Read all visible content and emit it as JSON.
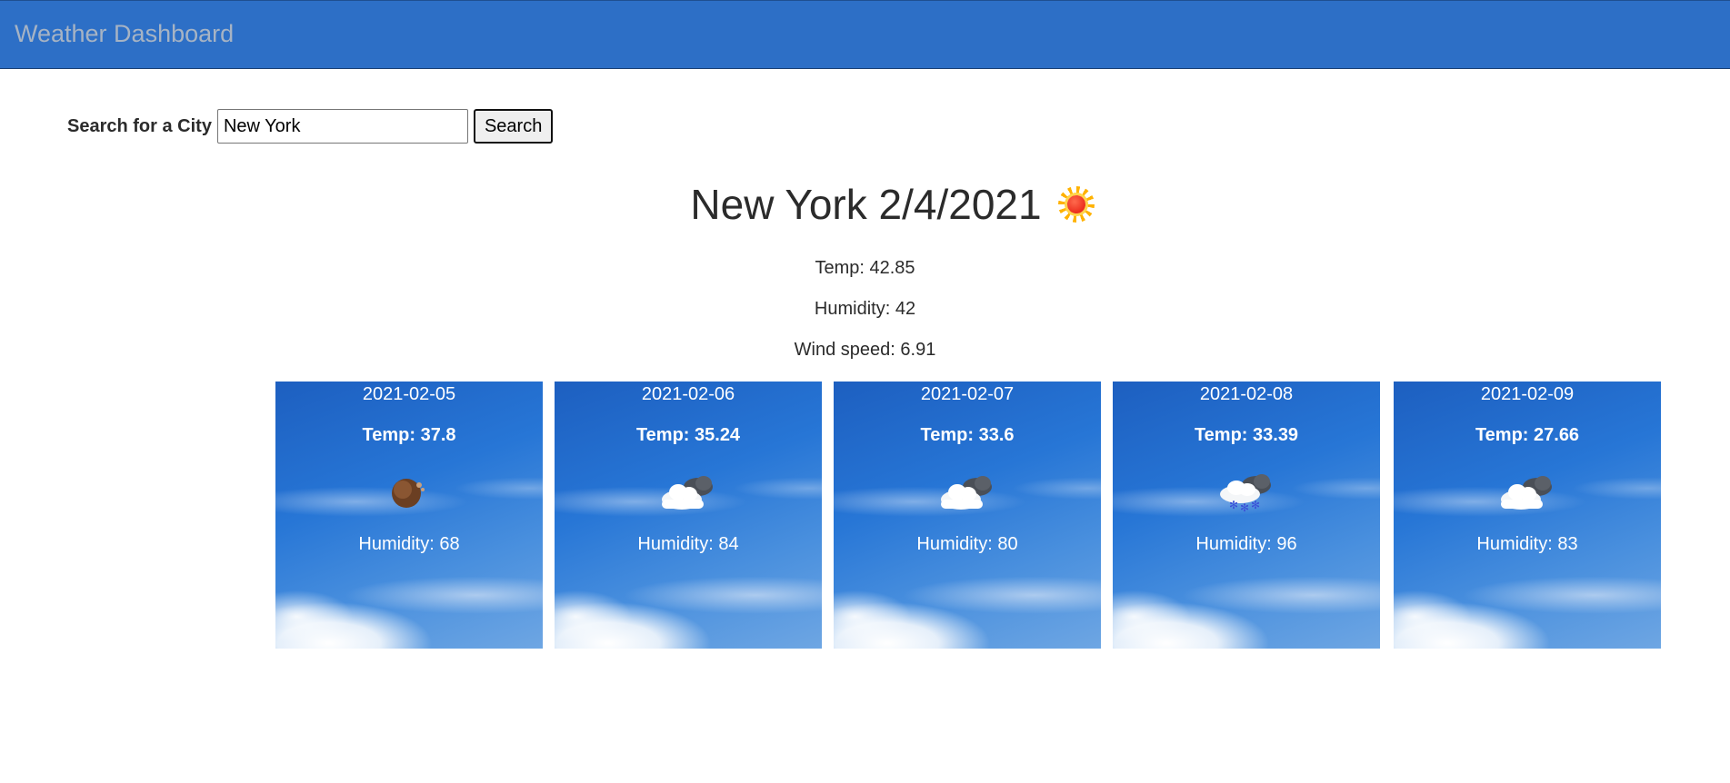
{
  "navbar": {
    "brand": "Weather Dashboard",
    "color": "#2d6fc6"
  },
  "search": {
    "label": "Search for a City",
    "value": "New York",
    "button_label": "Search"
  },
  "current": {
    "title": "New York 2/4/2021",
    "icon": "clear-sky-sun-icon",
    "temp": "Temp: 42.85",
    "humidity": "Humidity: 42",
    "wind": "Wind speed: 6.91"
  },
  "forecast": [
    {
      "date": "2021-02-05",
      "temp": "Temp: 37.8",
      "icon": "rain-cloud-icon",
      "humidity": "Humidity: 68"
    },
    {
      "date": "2021-02-06",
      "temp": "Temp: 35.24",
      "icon": "broken-clouds-icon",
      "humidity": "Humidity: 84"
    },
    {
      "date": "2021-02-07",
      "temp": "Temp: 33.6",
      "icon": "broken-clouds-icon",
      "humidity": "Humidity: 80"
    },
    {
      "date": "2021-02-08",
      "temp": "Temp: 33.39",
      "icon": "snow-cloud-icon",
      "humidity": "Humidity: 96"
    },
    {
      "date": "2021-02-09",
      "temp": "Temp: 27.66",
      "icon": "broken-clouds-icon",
      "humidity": "Humidity: 83"
    }
  ]
}
